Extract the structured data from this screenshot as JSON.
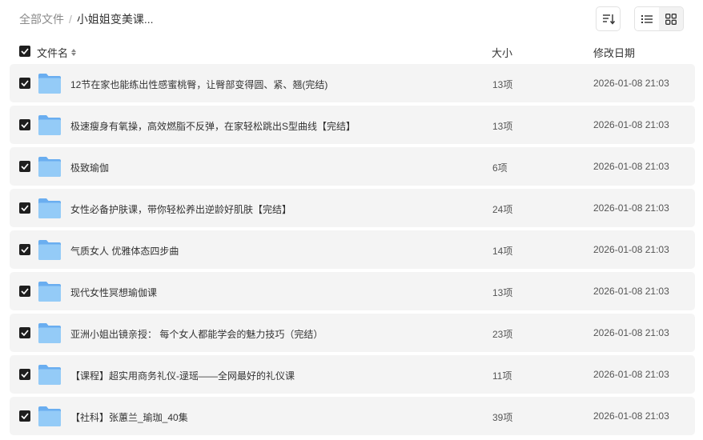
{
  "breadcrumb": {
    "root": "全部文件",
    "separator": "/",
    "current": "小姐姐变美课..."
  },
  "toolbar": {
    "sort_icon": "sort-lines-icon",
    "list_view_icon": "list-icon",
    "grid_view_icon": "grid-icon"
  },
  "columns": {
    "name": "文件名",
    "size": "大小",
    "date": "修改日期"
  },
  "colors": {
    "row_bg": "#f4f4f4",
    "checkbox": "#1f1f1f",
    "folder": "#8cc4f5"
  },
  "files": [
    {
      "name": "12节在家也能练出性感蜜桃臀，让臀部变得圆、紧、翘(完结)",
      "size": "13项",
      "date": "2026-01-08 21:03",
      "checked": true
    },
    {
      "name": "极速瘦身有氧操，高效燃脂不反弹，在家轻松跳出S型曲线【完结】",
      "size": "13项",
      "date": "2026-01-08 21:03",
      "checked": true
    },
    {
      "name": "极致瑜伽",
      "size": "6项",
      "date": "2026-01-08 21:03",
      "checked": true
    },
    {
      "name": "女性必备护肤课，带你轻松养出逆龄好肌肤【完结】",
      "size": "24项",
      "date": "2026-01-08 21:03",
      "checked": true
    },
    {
      "name": "气质女人 优雅体态四步曲",
      "size": "14项",
      "date": "2026-01-08 21:03",
      "checked": true
    },
    {
      "name": "现代女性冥想瑜伽课",
      "size": "13项",
      "date": "2026-01-08 21:03",
      "checked": true
    },
    {
      "name": "亚洲小姐出镜亲授： 每个女人都能学会的魅力技巧（完结）",
      "size": "23项",
      "date": "2026-01-08 21:03",
      "checked": true
    },
    {
      "name": "【课程】超实用商务礼仪-逯瑶——全网最好的礼仪课",
      "size": "11项",
      "date": "2026-01-08 21:03",
      "checked": true
    },
    {
      "name": "【社科】张蕙兰_瑜珈_40集",
      "size": "39项",
      "date": "2026-01-08 21:03",
      "checked": true
    }
  ]
}
